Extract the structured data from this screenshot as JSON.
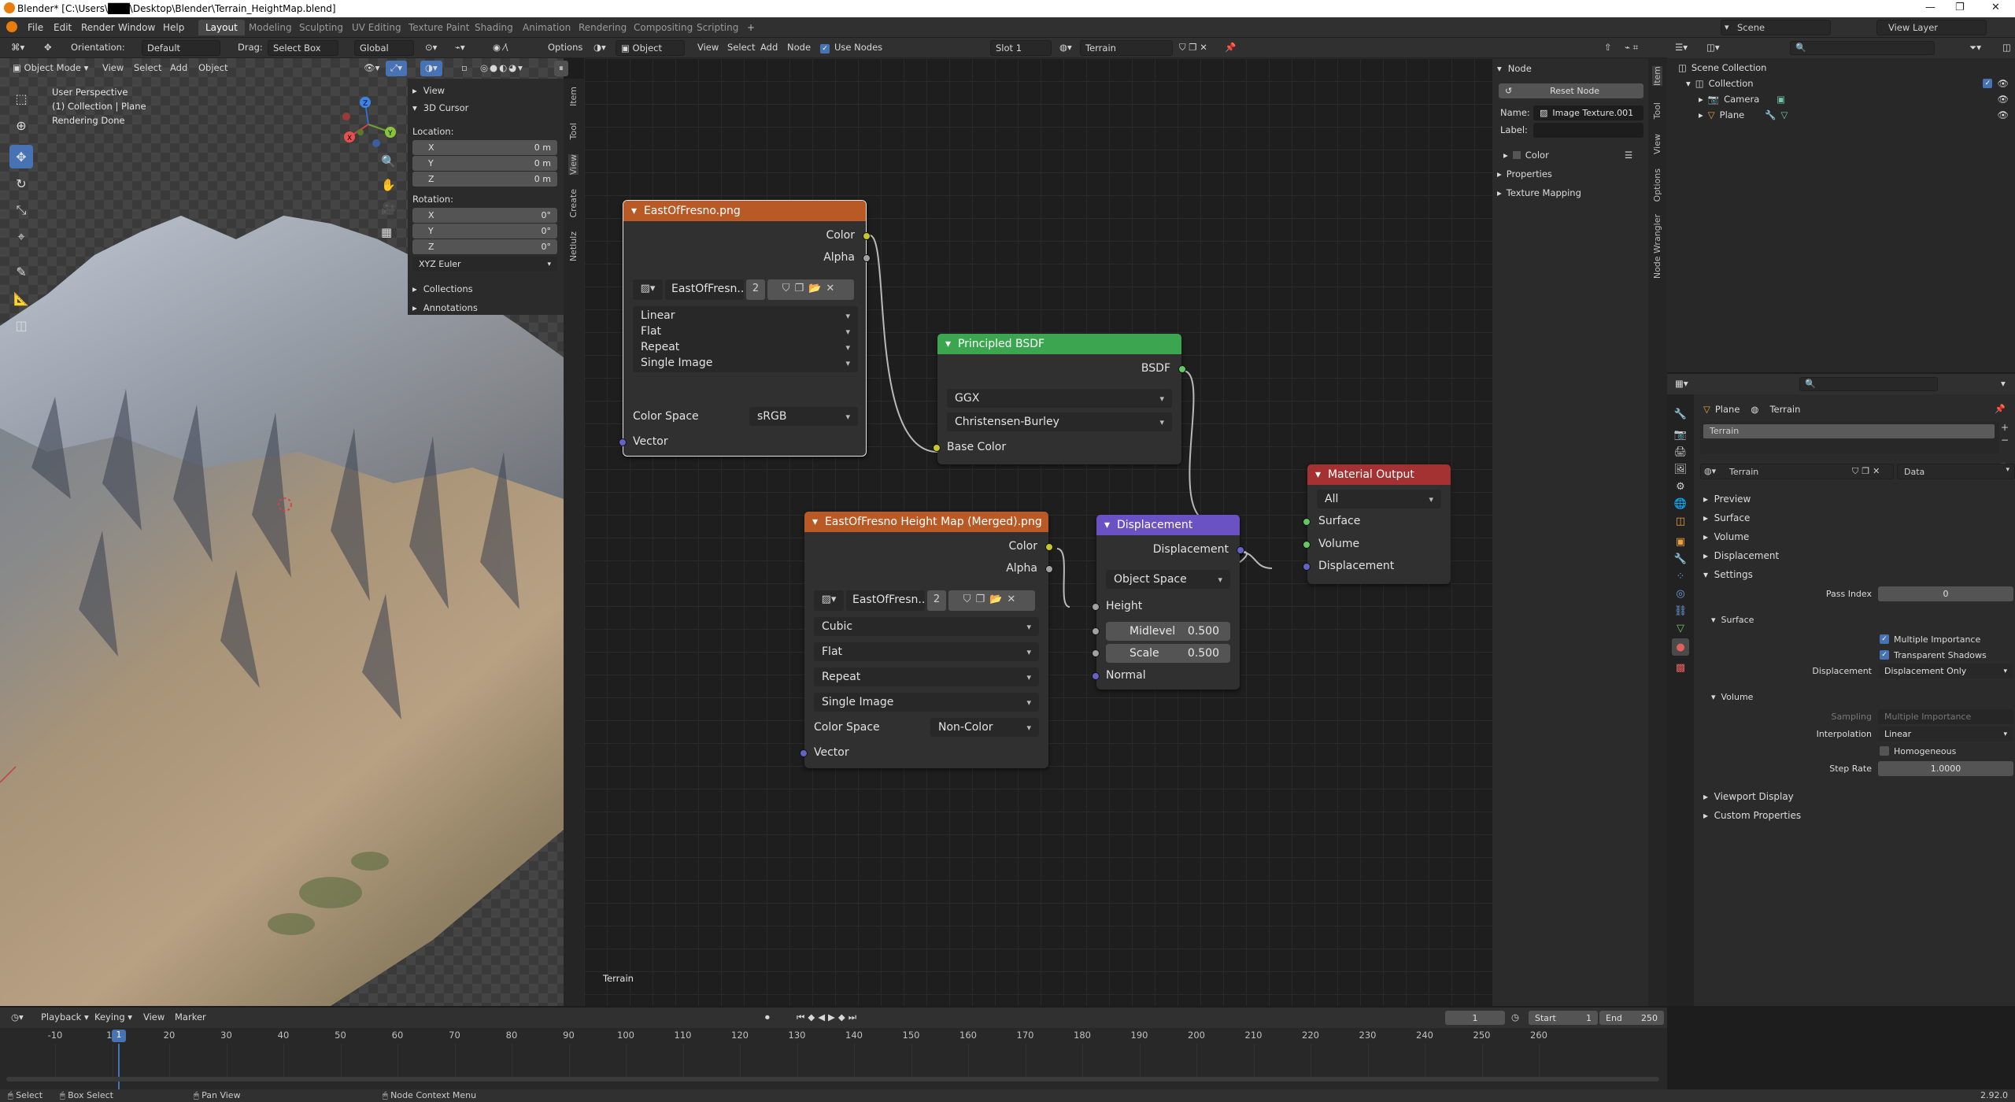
{
  "window": {
    "title": "Blender* [C:\\Users\\███\\Desktop\\Blender\\Terrain_HeightMap.blend]",
    "min": "—",
    "max": "❐",
    "close": "✕"
  },
  "menu": [
    "File",
    "Edit",
    "Render",
    "Window",
    "Help"
  ],
  "workspaces": [
    "Layout",
    "Modeling",
    "Sculpting",
    "UV Editing",
    "Texture Paint",
    "Shading",
    "Animation",
    "Rendering",
    "Compositing",
    "Scripting"
  ],
  "scene": {
    "label": "Scene",
    "view_layer": "View Layer"
  },
  "viewport": {
    "header": {
      "orientation_label": "Orientation:",
      "orientation": "Default",
      "drag_label": "Drag:",
      "drag": "Select Box",
      "transform": "Global",
      "options": "Options"
    },
    "header2": {
      "mode": "Object Mode",
      "items": [
        "View",
        "Select",
        "Add",
        "Object"
      ]
    },
    "overlay": {
      "line1": "User Perspective",
      "line2": "(1) Collection | Plane",
      "line3": "Rendering Done"
    },
    "gizmo": {
      "x": "X",
      "y": "Y",
      "z": "Z"
    },
    "npanel": {
      "view": "View",
      "cursor": "3D Cursor",
      "location": "Location:",
      "rotation": "Rotation:",
      "loc": [
        {
          "a": "X",
          "v": "0 m"
        },
        {
          "a": "Y",
          "v": "0 m"
        },
        {
          "a": "Z",
          "v": "0 m"
        }
      ],
      "rot": [
        {
          "a": "X",
          "v": "0°"
        },
        {
          "a": "Y",
          "v": "0°"
        },
        {
          "a": "Z",
          "v": "0°"
        }
      ],
      "euler": "XYZ Euler",
      "collections": "Collections",
      "annotations": "Annotations"
    },
    "tabs": [
      "Item",
      "Tool",
      "View",
      "Create",
      "Netlulz"
    ]
  },
  "node_editor": {
    "header": {
      "object": "Object",
      "items": [
        "View",
        "Select",
        "Add",
        "Node"
      ],
      "use_nodes": "Use Nodes",
      "slot": "Slot 1",
      "material": "Terrain"
    },
    "footer_label": "Terrain",
    "nodes": {
      "img1": {
        "title": "EastOfFresno.png",
        "out_color": "Color",
        "out_alpha": "Alpha",
        "image": "EastOfFresn...",
        "users": "2",
        "interp": "Linear",
        "proj": "Flat",
        "ext": "Repeat",
        "src": "Single Image",
        "cs_label": "Color Space",
        "cs": "sRGB",
        "vector": "Vector"
      },
      "bsdf": {
        "title": "Principled BSDF",
        "out": "BSDF",
        "dist": "GGX",
        "sss": "Christensen-Burley",
        "base": "Base Color"
      },
      "img2": {
        "title": "EastOfFresno Height Map (Merged).png",
        "out_color": "Color",
        "out_alpha": "Alpha",
        "image": "EastOfFresn...",
        "users": "2",
        "interp": "Cubic",
        "proj": "Flat",
        "ext": "Repeat",
        "src": "Single Image",
        "cs_label": "Color Space",
        "cs": "Non-Color",
        "vector": "Vector"
      },
      "disp": {
        "title": "Displacement",
        "out": "Displacement",
        "space": "Object Space",
        "height": "Height",
        "mid_label": "Midlevel",
        "mid": "0.500",
        "scale_label": "Scale",
        "scale": "0.500",
        "normal": "Normal"
      },
      "out": {
        "title": "Material Output",
        "target": "All",
        "surface": "Surface",
        "volume": "Volume",
        "displacement": "Displacement"
      }
    },
    "sidebar": {
      "node": "Node",
      "reset": "Reset Node",
      "name_label": "Name:",
      "name": "Image Texture.001",
      "label_label": "Label:",
      "color": "Color",
      "properties": "Properties",
      "texture_mapping": "Texture Mapping",
      "tabs": [
        "Item",
        "Tool",
        "View",
        "Options",
        "Node Wrangler"
      ]
    }
  },
  "outliner": {
    "root": "Scene Collection",
    "collection": "Collection",
    "camera": "Camera",
    "plane": "Plane"
  },
  "properties": {
    "crumb_obj": "Plane",
    "crumb_mat": "Terrain",
    "slot": "Terrain",
    "material": "Terrain",
    "data": "Data",
    "sections": {
      "preview": "Preview",
      "surface": "Surface",
      "volume": "Volume",
      "displacement": "Displacement",
      "settings": "Settings"
    },
    "pass_index_label": "Pass Index",
    "pass_index": "0",
    "sub_surface": "Surface",
    "multi_imp": "Multiple Importance",
    "trans_shadows": "Transparent Shadows",
    "disp_label": "Displacement",
    "disp": "Displacement Only",
    "sub_volume": "Volume",
    "sampling_label": "Sampling",
    "sampling": "Multiple Importance",
    "interp_label": "Interpolation",
    "interp": "Linear",
    "homogeneous": "Homogeneous",
    "step_label": "Step Rate",
    "step": "1.0000",
    "viewport_display": "Viewport Display",
    "custom_props": "Custom Properties"
  },
  "timeline": {
    "menu": [
      "Playback",
      "Keying",
      "View",
      "Marker"
    ],
    "current": "1",
    "start_label": "Start",
    "start": "1",
    "end_label": "End",
    "end": "250",
    "ticks": [
      "-10",
      "10",
      "20",
      "30",
      "40",
      "50",
      "60",
      "70",
      "80",
      "90",
      "100",
      "110",
      "120",
      "130",
      "140",
      "150",
      "160",
      "170",
      "180",
      "190",
      "200",
      "210",
      "220",
      "230",
      "240",
      "250",
      "260"
    ],
    "frame_marker": "1"
  },
  "status": {
    "select": "Select",
    "box_select": "Box Select",
    "pan_view": "Pan View",
    "node_context": "Node Context Menu",
    "version": "2.92.0"
  }
}
